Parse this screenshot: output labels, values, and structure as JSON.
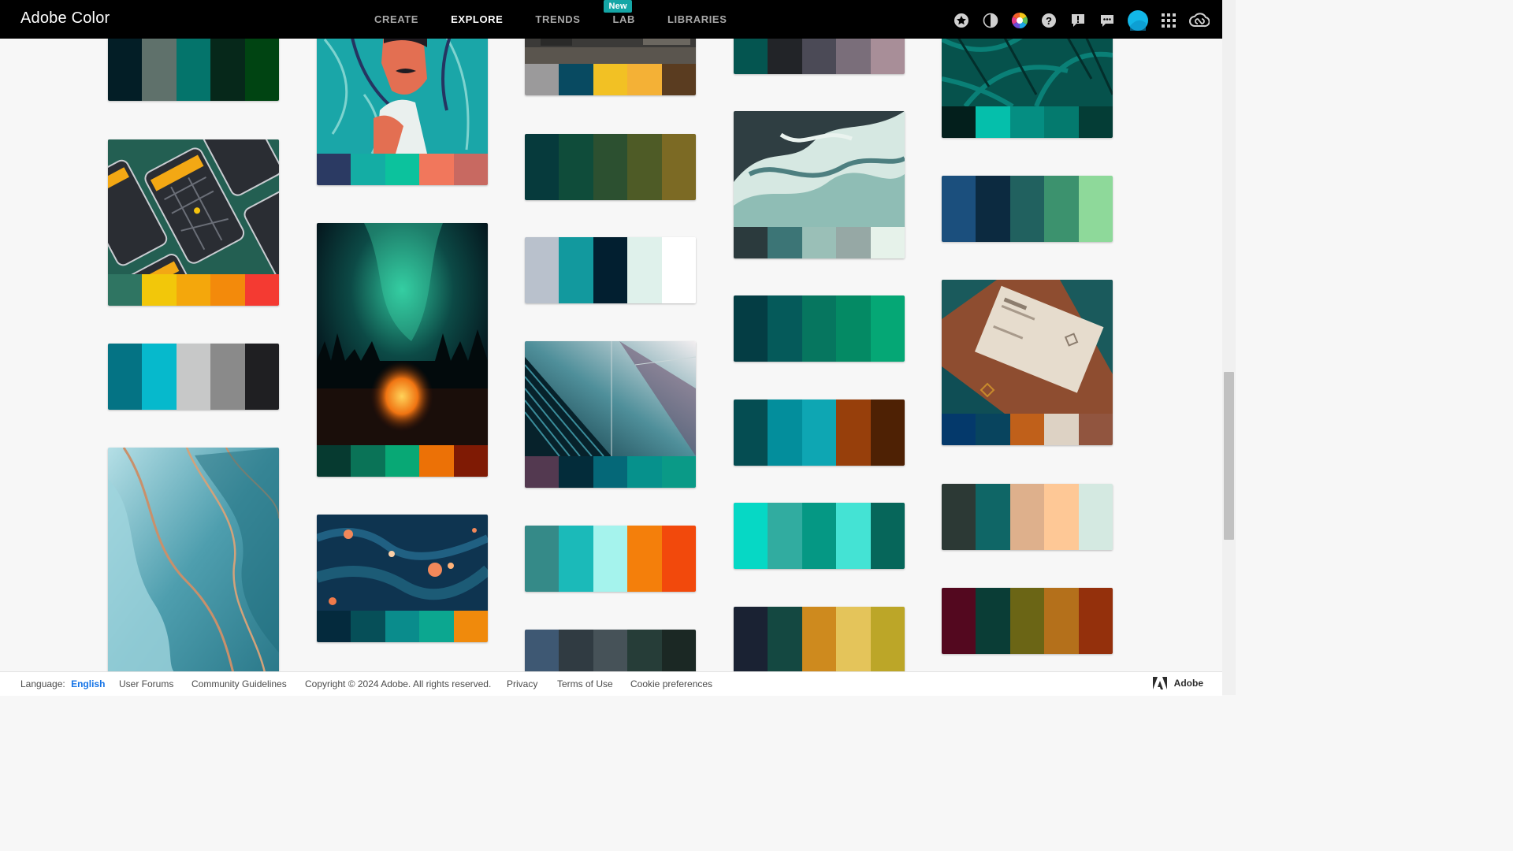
{
  "header": {
    "logo": "Adobe Color",
    "nav": [
      {
        "label": "CREATE",
        "active": false
      },
      {
        "label": "EXPLORE",
        "active": true
      },
      {
        "label": "TRENDS",
        "active": false
      },
      {
        "label": "LAB",
        "active": false,
        "badge": "New"
      },
      {
        "label": "LIBRARIES",
        "active": false
      }
    ],
    "tools": [
      "star-icon",
      "contrast-icon",
      "color-wheel-icon",
      "help-icon",
      "feedback-icon",
      "chat-icon",
      "avatar",
      "apps-grid-icon",
      "creative-cloud-icon"
    ]
  },
  "gallery": {
    "columns": [
      [
        {
          "kind": "palette",
          "colors": [
            "#031e26",
            "#5f716b",
            "#04746b",
            "#06281a",
            "#004412"
          ]
        },
        {
          "kind": "image",
          "image": "phones",
          "colors": [
            "#2f7562",
            "#f2c70a",
            "#f4a70c",
            "#f38a0b",
            "#f43a32"
          ]
        },
        {
          "kind": "palette",
          "colors": [
            "#047384",
            "#06b9cc",
            "#c7c8c8",
            "#8a8a8a",
            "#1f1f22"
          ]
        },
        {
          "kind": "image",
          "image": "watercolor",
          "colors": []
        }
      ],
      [
        {
          "kind": "image",
          "image": "illustration",
          "colors": [
            "#2b3a63",
            "#14ada4",
            "#0cc29d",
            "#f1775c",
            "#c86961"
          ]
        },
        {
          "kind": "image",
          "image": "aurora",
          "colors": [
            "#063a30",
            "#0a7357",
            "#08a875",
            "#ec7106",
            "#7f1a04"
          ]
        },
        {
          "kind": "image",
          "image": "marble",
          "colors": [
            "#042a3d",
            "#064f58",
            "#0a8c8c",
            "#0ca790",
            "#f08a0c"
          ]
        }
      ],
      [
        {
          "kind": "image",
          "image": "interior",
          "colors": [
            "#9b9a9b",
            "#084a61",
            "#f2c124",
            "#f4b136",
            "#5a3c20"
          ]
        },
        {
          "kind": "palette",
          "colors": [
            "#063a3c",
            "#0f4c3a",
            "#2c5030",
            "#4e5b26",
            "#7c6a24"
          ]
        },
        {
          "kind": "palette",
          "colors": [
            "#b9c1cc",
            "#12999e",
            "#021f30",
            "#dff1eb",
            "#ffffff"
          ]
        },
        {
          "kind": "image",
          "image": "architecture",
          "colors": [
            "#533950",
            "#032c3a",
            "#056878",
            "#06918c",
            "#0a9a87"
          ]
        },
        {
          "kind": "palette",
          "colors": [
            "#358a88",
            "#1bbab9",
            "#a5f3ed",
            "#f47f0b",
            "#f2490c"
          ]
        },
        {
          "kind": "palette",
          "colors": [
            "#3e5873",
            "#303b42",
            "#465258",
            "#263d38",
            "#1b2824"
          ]
        }
      ],
      [
        {
          "kind": "palette",
          "colors": [
            "#045550",
            "#222428",
            "#4b4a56",
            "#7a6e7a",
            "#a88e98"
          ]
        },
        {
          "kind": "image",
          "image": "fluid",
          "colors": [
            "#2b3a3d",
            "#3c7576",
            "#9abfb7",
            "#96a8a5",
            "#e6f2ea"
          ]
        },
        {
          "kind": "palette",
          "colors": [
            "#043d44",
            "#055a5a",
            "#06765f",
            "#048a64",
            "#05a775"
          ]
        },
        {
          "kind": "palette",
          "colors": [
            "#054d52",
            "#038e9c",
            "#0ea6b3",
            "#973f0b",
            "#4e2104"
          ]
        },
        {
          "kind": "palette",
          "colors": [
            "#06d8c5",
            "#31aca0",
            "#059884",
            "#44e3d4",
            "#06665a"
          ]
        },
        {
          "kind": "palette",
          "colors": [
            "#1a2233",
            "#144841",
            "#ce8a1e",
            "#e4c45a",
            "#bca628"
          ]
        }
      ],
      [
        {
          "kind": "image",
          "image": "leaves",
          "colors": [
            "#031f1c",
            "#05bfab",
            "#058e82",
            "#047a6e",
            "#043d36"
          ]
        },
        {
          "kind": "palette",
          "colors": [
            "#1b4f7d",
            "#0c2a40",
            "#21615f",
            "#3c926e",
            "#8ed99a"
          ]
        },
        {
          "kind": "image",
          "image": "businesscard",
          "colors": [
            "#04396b",
            "#08445e",
            "#c0601a",
            "#ddd2c4",
            "#91553f"
          ]
        },
        {
          "kind": "palette",
          "colors": [
            "#2c3935",
            "#0f6666",
            "#deb08c",
            "#fec896",
            "#d4e9e1"
          ]
        },
        {
          "kind": "palette",
          "colors": [
            "#53081f",
            "#0a3d36",
            "#6b6515",
            "#b4701b",
            "#94300c"
          ]
        }
      ]
    ]
  },
  "footer": {
    "language_label": "Language:",
    "language_value": "English",
    "links": [
      "User Forums",
      "Community Guidelines",
      "Copyright © 2024 Adobe. All rights reserved.",
      "Privacy",
      "Terms of Use",
      "Cookie preferences"
    ],
    "brand": "Adobe"
  },
  "colors": {
    "accent": "#15a6a6",
    "link": "#1473e6",
    "header_bg": "#000000"
  }
}
